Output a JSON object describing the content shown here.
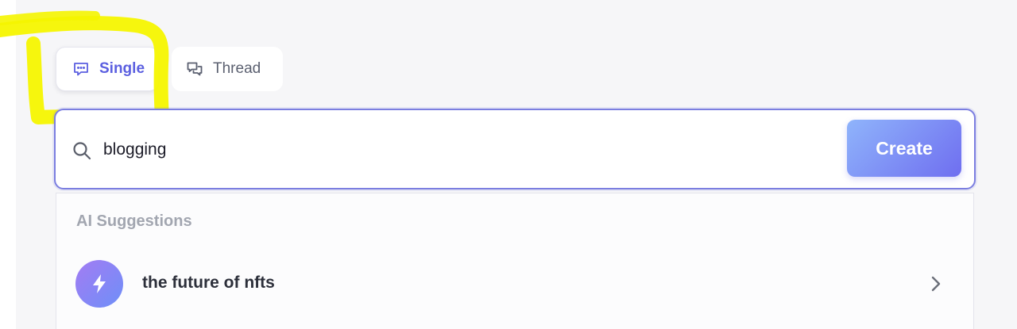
{
  "tabs": [
    {
      "label": "Single",
      "icon": "chat-bubble-icon",
      "active": true
    },
    {
      "label": "Thread",
      "icon": "chat-bubbles-icon",
      "active": false
    }
  ],
  "search": {
    "value": "blogging",
    "icon": "search-icon"
  },
  "create_button": {
    "label": "Create"
  },
  "suggestions": {
    "heading": "AI Suggestions",
    "items": [
      {
        "label": "the future of nfts",
        "icon": "lightning-icon"
      }
    ]
  },
  "colors": {
    "accent": "#5b5fe0",
    "highlight": "#f5f500",
    "button_gradient_start": "#8fb4fb",
    "button_gradient_end": "#6f6ef0"
  }
}
